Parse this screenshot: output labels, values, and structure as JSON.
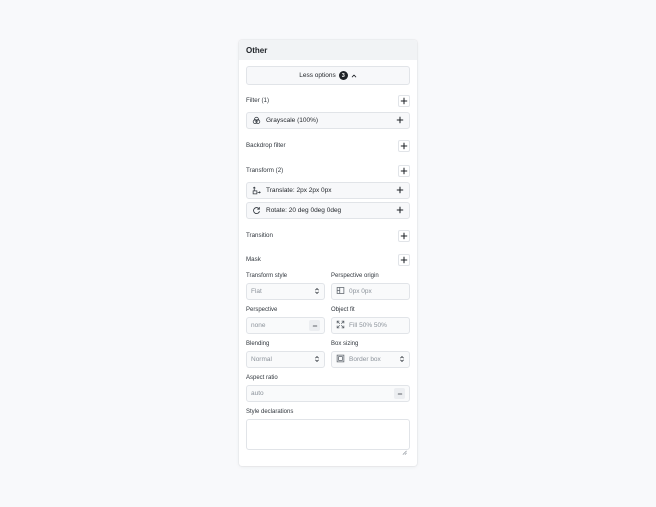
{
  "panel": {
    "title": "Other",
    "less_options": {
      "label": "Less options",
      "count": "3"
    },
    "filter": {
      "label": "Filter (1)",
      "items": [
        {
          "label": "Grayscale (100%)",
          "icon": "grayscale-icon"
        }
      ]
    },
    "backdrop_filter": {
      "label": "Backdrop filter"
    },
    "transform": {
      "label": "Transform (2)",
      "items": [
        {
          "label": "Translate: 2px 2px 0px",
          "icon": "translate-icon"
        },
        {
          "label": "Rotate: 20 deg 0deg 0deg",
          "icon": "rotate-icon"
        }
      ]
    },
    "transition": {
      "label": "Transition"
    },
    "mask": {
      "label": "Mask"
    },
    "transform_style": {
      "label": "Transform style",
      "value": "Flat"
    },
    "perspective_origin": {
      "label": "Perspective origin",
      "placeholder": "0px 0px"
    },
    "perspective": {
      "label": "Perspective",
      "placeholder": "none"
    },
    "object_fit": {
      "label": "Object fit",
      "placeholder": "Fill 50% 50%"
    },
    "blending": {
      "label": "Blending",
      "value": "Normal"
    },
    "box_sizing": {
      "label": "Box sizing",
      "value": "Border box"
    },
    "aspect_ratio": {
      "label": "Aspect ratio",
      "placeholder": "auto"
    },
    "style_declarations": {
      "label": "Style declarations",
      "value": ""
    }
  },
  "colors": {
    "background": "#f8f9fb",
    "panel": "#ffffff",
    "header": "#f1f3f5",
    "border": "#e1e4e8",
    "text": "#1f2328",
    "muted": "#8b929a"
  }
}
